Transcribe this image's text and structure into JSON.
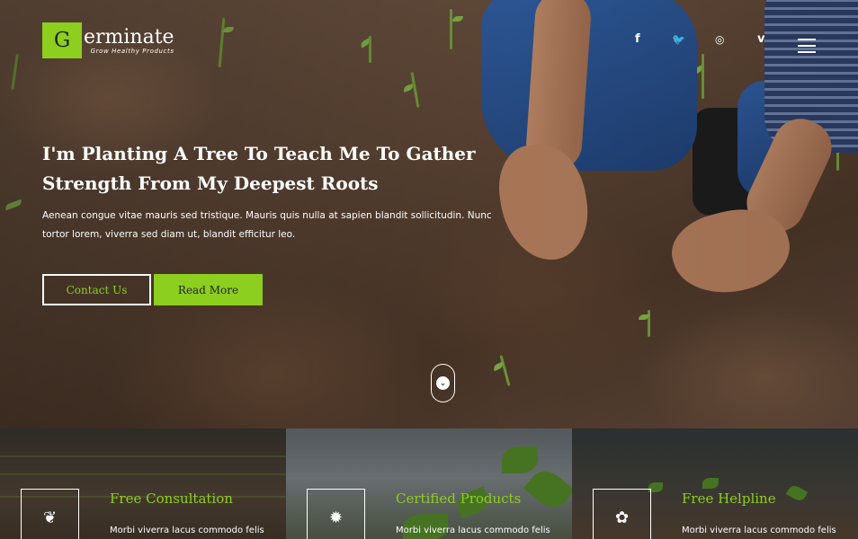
{
  "brand": {
    "logo_letter": "G",
    "name": "erminate",
    "tagline": "Grow Healthy Products",
    "accent_color": "#8ccf1e"
  },
  "header": {
    "social": [
      {
        "icon": "facebook-icon",
        "glyph": "f"
      },
      {
        "icon": "twitter-icon",
        "glyph": "🐦"
      },
      {
        "icon": "dribbble-icon",
        "glyph": "◎"
      },
      {
        "icon": "vimeo-icon",
        "glyph": "v"
      }
    ],
    "menu_icon": "hamburger-menu-icon"
  },
  "hero": {
    "title": "I'm Planting A Tree To Teach Me To Gather Strength From My Deepest Roots",
    "description": "Aenean congue vitae mauris sed tristique. Mauris quis nulla at sapien blandit sollicitudin. Nunc tortor lorem, viverra sed diam ut, blandit efficitur leo.",
    "button_contact": "Contact Us",
    "button_more": "Read More",
    "scroll_icon": "chevron-down-icon"
  },
  "features": [
    {
      "icon": "sprout-icon",
      "glyph": "❦",
      "title": "Free Consultation",
      "text": "Morbi viverra lacus commodo felis"
    },
    {
      "icon": "flower-icon",
      "glyph": "✹",
      "title": "Certified Products",
      "text": "Morbi viverra lacus commodo felis"
    },
    {
      "icon": "leaf-icon",
      "glyph": "✿",
      "title": "Free Helpline",
      "text": "Morbi viverra lacus commodo felis"
    }
  ]
}
